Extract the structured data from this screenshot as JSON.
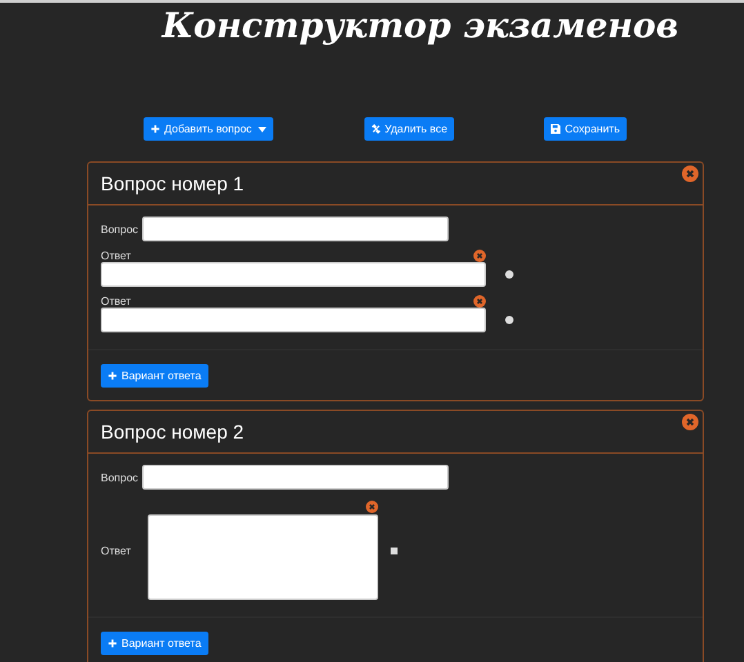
{
  "title": "Конструктор экзаменов",
  "toolbar": [
    {
      "kind": "add",
      "label": "Добавить вопрос"
    },
    {
      "kind": "delete",
      "label": "Удалить все"
    },
    {
      "kind": "save",
      "label": "Сохранить"
    }
  ],
  "questions": [
    {
      "kind": "single",
      "title": "Вопрос номер 1",
      "question_label": "Вопрос",
      "answers": [
        {
          "label": "Ответ",
          "checked": false
        },
        {
          "label": "Ответ",
          "checked": false
        }
      ],
      "add_button": "Вариант ответа"
    },
    {
      "kind": "multi",
      "title": "Вопрос номер 2",
      "question_label": "Вопрос",
      "answers": [
        {
          "label": "Ответ",
          "checked": false
        }
      ],
      "add_button": "Вариант ответа"
    }
  ]
}
